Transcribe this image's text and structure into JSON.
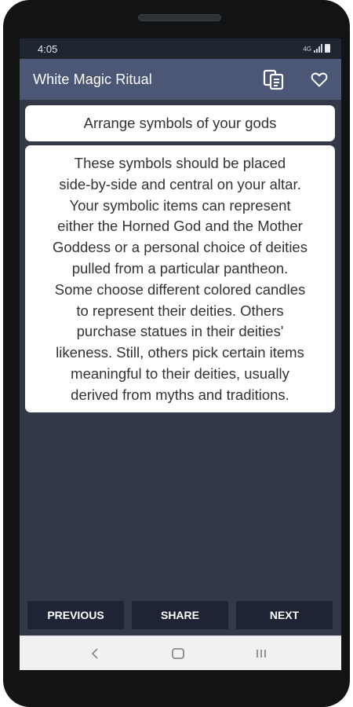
{
  "status_bar": {
    "time": "4:05",
    "network_label": "4G",
    "icons": [
      "signal-icon",
      "battery-icon"
    ]
  },
  "app_bar": {
    "title": "White Magic Ritual",
    "actions": [
      "copy-icon",
      "heart-icon"
    ]
  },
  "content": {
    "heading": "Arrange symbols of your gods",
    "body_lines": [
      "These symbols should be placed",
      "side-by-side and central on your altar.",
      "Your symbolic items can represent",
      "either the Horned God and the Mother",
      "Goddess or a personal choice of deities",
      "pulled from a particular pantheon.",
      "Some choose different colored candles",
      "to represent their deities. Others",
      "purchase statues in their deities'",
      "likeness. Still, others pick certain items",
      "meaningful to their deities, usually",
      "derived from myths and traditions."
    ]
  },
  "buttons": {
    "previous": "PREVIOUS",
    "share": "SHARE",
    "next": "NEXT"
  },
  "system_nav": {
    "keys": [
      "back-icon",
      "home-icon",
      "recents-icon"
    ]
  },
  "colors": {
    "app_bar": "#4c5675",
    "background": "#323847",
    "button": "#1e2435",
    "card": "#ffffff",
    "text": "#333333"
  }
}
